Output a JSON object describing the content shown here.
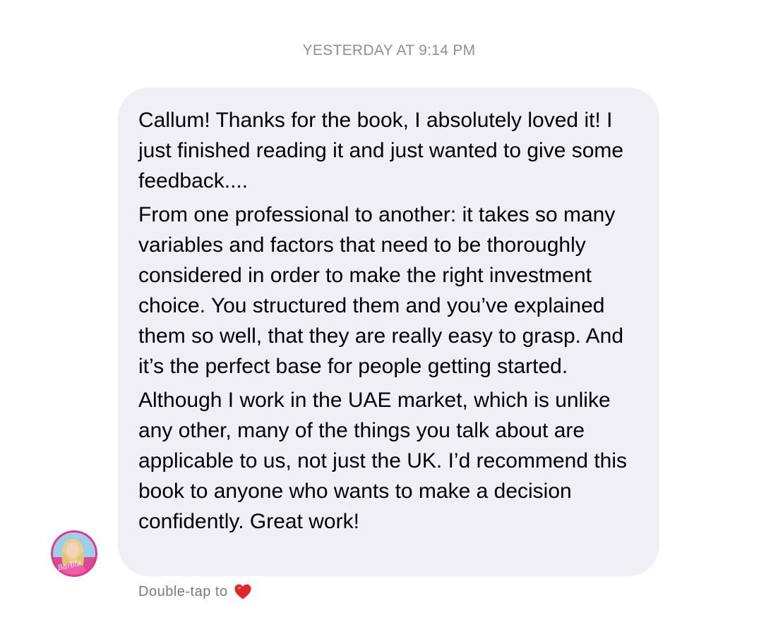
{
  "timestamp": "YESTERDAY AT 9:14 PM",
  "message": {
    "paragraphs": [
      "Callum! Thanks for the book, I absolutely loved it! I just finished reading it and just wanted to give some feedback....",
      "From one professional to another: it takes so many variables and factors that need to be thoroughly considered in order to make the right investment choice. You structured them and you’ve explained them so well, that they are really easy to grasp. And it’s the perfect base for people getting started.",
      "Although I work in the UAE market, which is unlike any other, many of the things you talk about are applicable to us, not just the UK. I’d recommend this book to anyone who wants to make a decision confidently. Great work!"
    ]
  },
  "sender": {
    "avatar_icon": "profile-photo-avatar",
    "avatar_badge_text": "Barbie"
  },
  "reaction_hint": {
    "label": "Double-tap to",
    "icon": "heart-icon"
  },
  "colors": {
    "bubble_bg": "#efeff4",
    "timestamp": "#8e8e93",
    "heart": "#e2242f",
    "avatar_ring": "#e8338b"
  }
}
